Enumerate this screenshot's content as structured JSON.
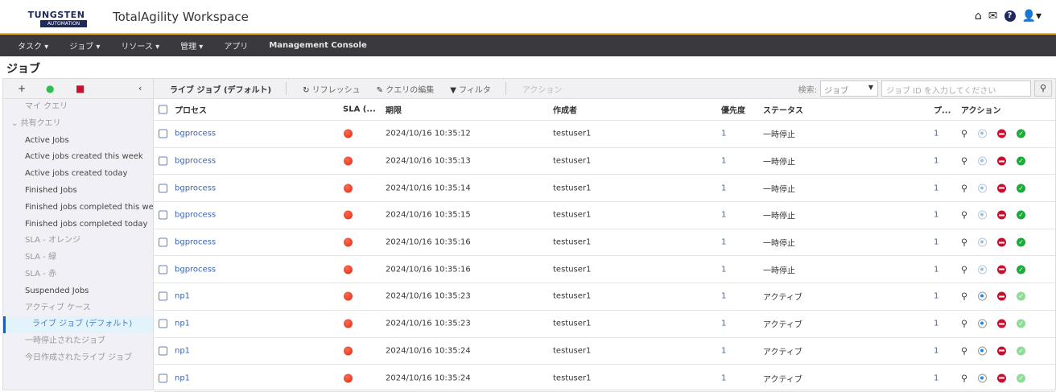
{
  "header": {
    "logo_top": "TUNGSTEN",
    "logo_bottom": "AUTOMATION",
    "title": "TotalAgility Workspace",
    "icons": [
      "home-icon",
      "mail-open-icon",
      "help-icon",
      "user-icon"
    ]
  },
  "nav": {
    "items": [
      {
        "label": "タスク ▾"
      },
      {
        "label": "ジョブ ▾"
      },
      {
        "label": "リソース ▾"
      },
      {
        "label": "管理 ▾"
      },
      {
        "label": "アプリ"
      },
      {
        "label": "Management Console"
      }
    ]
  },
  "page_title": "ジョブ",
  "sidebar": {
    "items": [
      {
        "label": "マイ クエリ"
      },
      {
        "label": "⌄  共有クエリ"
      },
      {
        "label": "Active Jobs"
      },
      {
        "label": "Active jobs created this week"
      },
      {
        "label": "Active jobs created today"
      },
      {
        "label": "Finished Jobs"
      },
      {
        "label": "Finished jobs completed this week"
      },
      {
        "label": "Finished jobs completed today"
      },
      {
        "label": "SLA - オレンジ"
      },
      {
        "label": "SLA - 緑"
      },
      {
        "label": "SLA - 赤"
      },
      {
        "label": "Suspended Jobs"
      },
      {
        "label": "アクティブ ケース"
      },
      {
        "label": "ライブ ジョブ (デフォルト)"
      },
      {
        "label": "一時停止されたジョブ"
      },
      {
        "label": "今日作成されたライブ ジョブ"
      }
    ]
  },
  "toolbar": {
    "current_query": "ライブ ジョブ (デフォルト)",
    "refresh": "リフレッシュ",
    "edit_query": "クエリの編集",
    "filter": "フィルタ",
    "action": "アクション",
    "search_label": "検索:",
    "search_type": "ジョブ",
    "search_placeholder": "ジョブ ID を入力してください"
  },
  "table": {
    "headers": {
      "process": "プロセス",
      "sla": "SLA (...",
      "due": "期限",
      "creator": "作成者",
      "priority": "優先度",
      "status": "ステータス",
      "p": "プ...",
      "actions": "アクション"
    },
    "rows": [
      {
        "process": "bgprocess",
        "due": "2024/10/16 10:35:12",
        "creator": "testuser1",
        "priority": "1",
        "status": "一時停止",
        "p": "1"
      },
      {
        "process": "bgprocess",
        "due": "2024/10/16 10:35:13",
        "creator": "testuser1",
        "priority": "1",
        "status": "一時停止",
        "p": "1"
      },
      {
        "process": "bgprocess",
        "due": "2024/10/16 10:35:14",
        "creator": "testuser1",
        "priority": "1",
        "status": "一時停止",
        "p": "1"
      },
      {
        "process": "bgprocess",
        "due": "2024/10/16 10:35:15",
        "creator": "testuser1",
        "priority": "1",
        "status": "一時停止",
        "p": "1"
      },
      {
        "process": "bgprocess",
        "due": "2024/10/16 10:35:16",
        "creator": "testuser1",
        "priority": "1",
        "status": "一時停止",
        "p": "1"
      },
      {
        "process": "bgprocess",
        "due": "2024/10/16 10:35:16",
        "creator": "testuser1",
        "priority": "1",
        "status": "一時停止",
        "p": "1"
      },
      {
        "process": "np1",
        "due": "2024/10/16 10:35:23",
        "creator": "testuser1",
        "priority": "1",
        "status": "アクティブ",
        "p": "1"
      },
      {
        "process": "np1",
        "due": "2024/10/16 10:35:23",
        "creator": "testuser1",
        "priority": "1",
        "status": "アクティブ",
        "p": "1"
      },
      {
        "process": "np1",
        "due": "2024/10/16 10:35:24",
        "creator": "testuser1",
        "priority": "1",
        "status": "アクティブ",
        "p": "1"
      },
      {
        "process": "np1",
        "due": "2024/10/16 10:35:24",
        "creator": "testuser1",
        "priority": "1",
        "status": "アクティブ",
        "p": "1"
      }
    ]
  },
  "colors": {
    "accent": "#f2b81c",
    "nav_bg": "#3a3a3e",
    "link": "#3a64b0",
    "sla_red": "#e02a10"
  }
}
